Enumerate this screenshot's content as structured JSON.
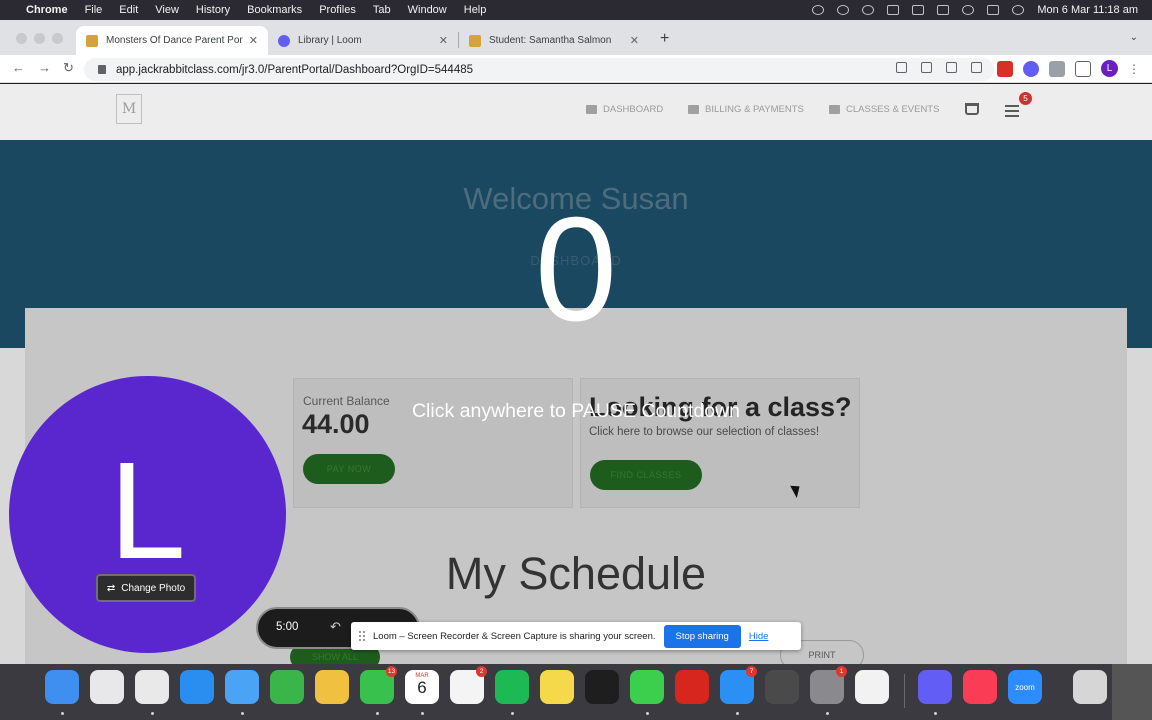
{
  "menubar": {
    "app": "Chrome",
    "items": [
      "File",
      "Edit",
      "View",
      "History",
      "Bookmarks",
      "Profiles",
      "Tab",
      "Window",
      "Help"
    ],
    "clock": "Mon 6 Mar  11:18 am"
  },
  "tabs": [
    {
      "title": "Monsters Of Dance Parent Portal",
      "active": true,
      "icon": "monsters-favicon",
      "color": "#d8a23a"
    },
    {
      "title": "Library | Loom",
      "active": false,
      "icon": "loom-favicon",
      "color": "#625df5"
    },
    {
      "title": "Student: Samantha Salmon",
      "active": false,
      "icon": "jackrabbit-favicon",
      "color": "#d8a23a"
    }
  ],
  "address_bar": {
    "url": "app.jackrabbitclass.com/jr3.0/ParentPortal/Dashboard?OrgID=544485"
  },
  "profile_initial": "L",
  "site": {
    "logo_text": "M",
    "nav": [
      {
        "label": "DASHBOARD",
        "icon": "dashboard-icon"
      },
      {
        "label": "BILLING & PAYMENTS",
        "icon": "billing-icon"
      },
      {
        "label": "CLASSES & EVENTS",
        "icon": "classes-icon"
      }
    ],
    "notification_count": "5",
    "welcome": "Welcome Susan",
    "hero_sub": "DASHBOARD",
    "balance_label": "Current Balance",
    "balance_value": "44.00",
    "pay_now": "PAY NOW",
    "class_title": "Looking for a class?",
    "class_sub": "Click here to browse our selection of classes!",
    "find_classes": "FIND CLASSES",
    "schedule_title": "My Schedule",
    "show_all": "SHOW ALL",
    "print": "PRINT"
  },
  "loom": {
    "countdown": "0",
    "countdown_hint": "Click anywhere to PAUSE Countdown",
    "camera_initial": "L",
    "change_photo": "Change Photo",
    "timer": "5:00",
    "share_message": "Loom – Screen Recorder & Screen Capture is sharing your screen.",
    "stop_sharing": "Stop sharing",
    "hide": "Hide",
    "camera_color": "#5a27cf"
  },
  "dock": {
    "apps": [
      {
        "name": "finder-icon",
        "color": "#3f8ff0"
      },
      {
        "name": "launchpad-icon",
        "color": "#e8e8ea"
      },
      {
        "name": "chrome-icon",
        "color": "#e9e9e9"
      },
      {
        "name": "safari-icon",
        "color": "#2a8ef0"
      },
      {
        "name": "mail-icon",
        "color": "#4aa3f5"
      },
      {
        "name": "numbers-icon",
        "color": "#39b54a"
      },
      {
        "name": "photos-icon",
        "color": "#f0c040"
      },
      {
        "name": "facetime-icon",
        "color": "#39c14d",
        "badge": "13"
      },
      {
        "name": "calendar-icon",
        "color": "#ffffff",
        "month": "MAR",
        "day": "6"
      },
      {
        "name": "reminders-icon",
        "color": "#f4f4f4",
        "badge": "2"
      },
      {
        "name": "spotify-icon",
        "color": "#1db954"
      },
      {
        "name": "notes-icon",
        "color": "#f6d94a"
      },
      {
        "name": "appletv-icon",
        "color": "#1e1e1e"
      },
      {
        "name": "messages-icon",
        "color": "#3ccf4e"
      },
      {
        "name": "acrobat-icon",
        "color": "#d7261e"
      },
      {
        "name": "appstore-icon",
        "color": "#2c8ff4",
        "badge": "7"
      },
      {
        "name": "instruments-icon",
        "color": "#4a4a4a"
      },
      {
        "name": "system-settings-icon",
        "color": "#8a8a8e",
        "badge": "1"
      },
      {
        "name": "pencil-app-icon",
        "color": "#f2f2f2"
      },
      {
        "name": "loom-icon",
        "color": "#625df5"
      },
      {
        "name": "music-icon",
        "color": "#fa3d55"
      },
      {
        "name": "zoom-icon",
        "color": "#2d8cff",
        "label": "zoom"
      },
      {
        "name": "trash-icon",
        "color": "#d6d6d6"
      }
    ]
  }
}
